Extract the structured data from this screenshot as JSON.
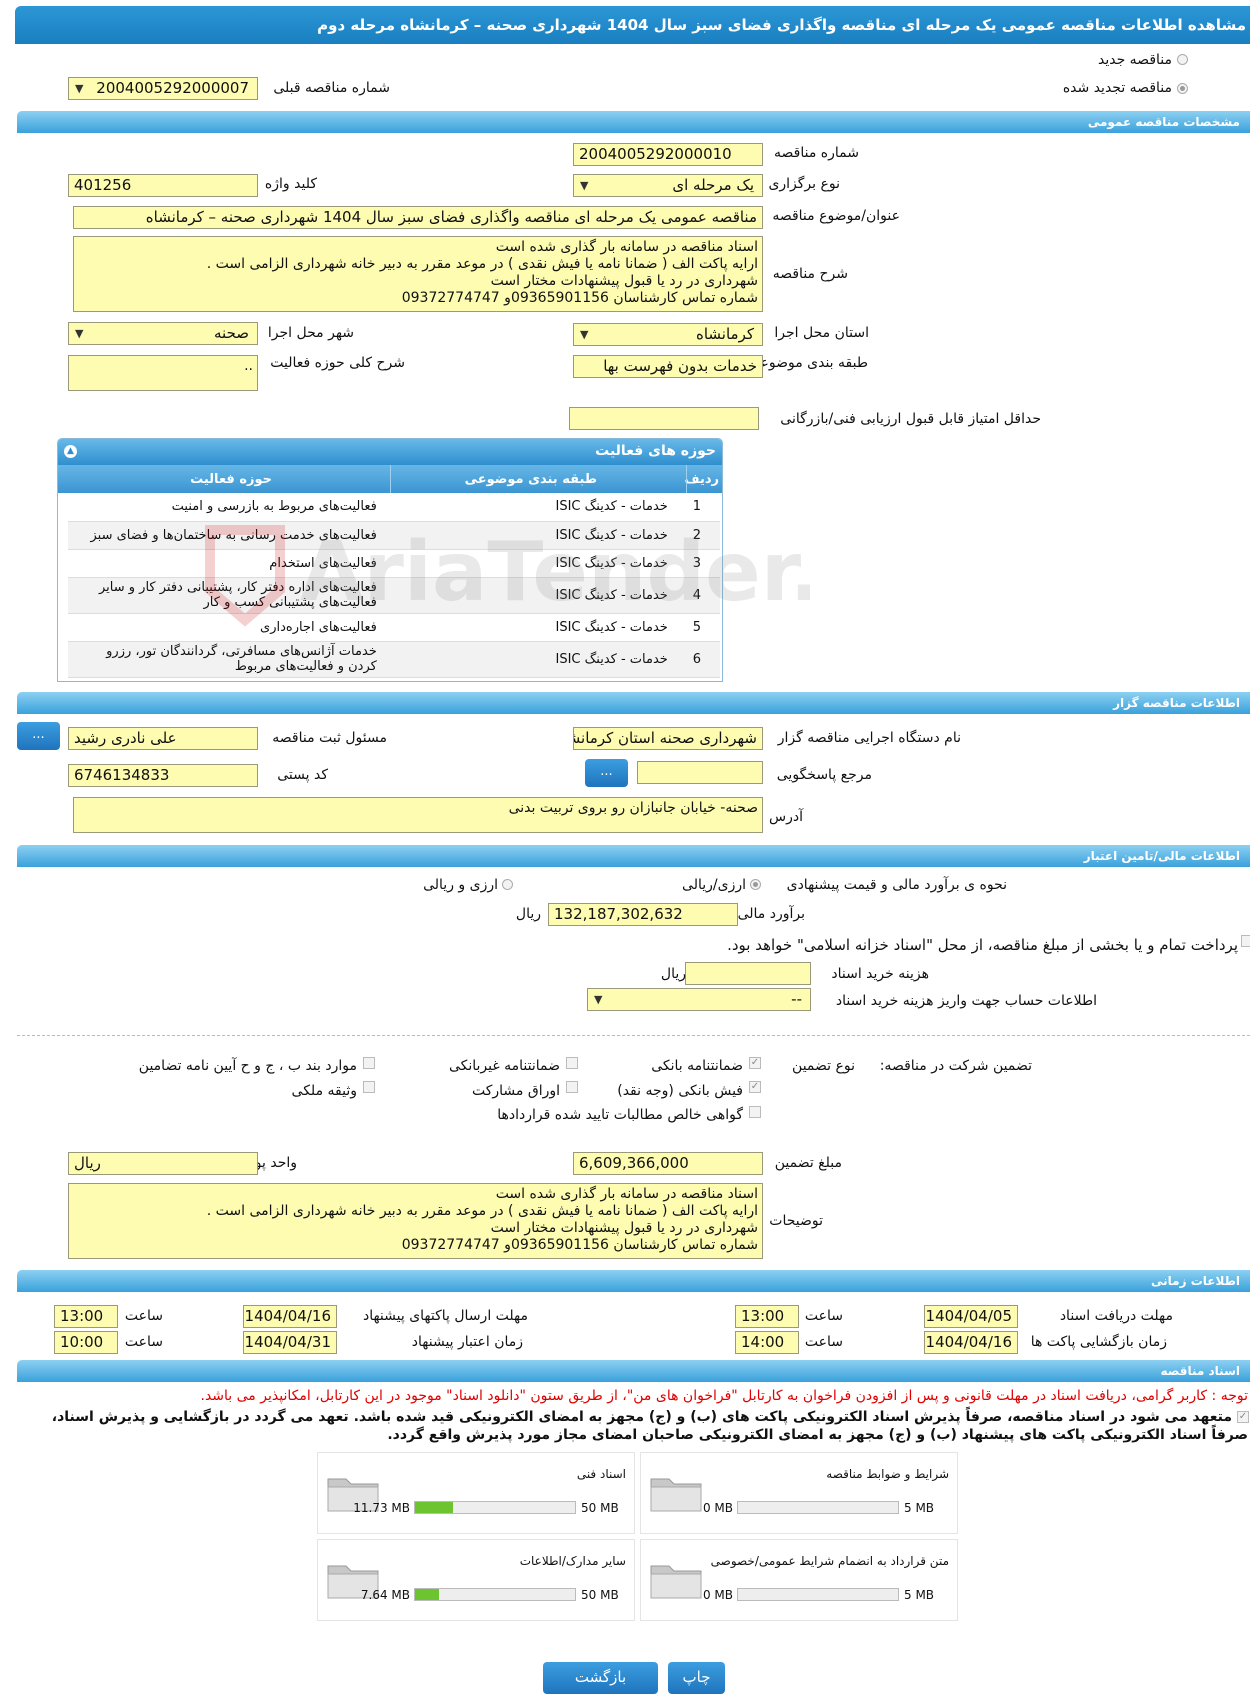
{
  "page_title": "مشاهده اطلاعات مناقصه عمومی یک مرحله ای مناقصه واگذاری فضای سبز سال 1404 شهرداری صحنه – کرمانشاه مرحله دوم",
  "top": {
    "new_tender": "مناقصه جدید",
    "renewed_tender": "مناقصه تجدید شده",
    "prev_number_label": "شماره مناقصه قبلی",
    "prev_number": "2004005292000007"
  },
  "general": {
    "section": "مشخصات مناقصه عمومی",
    "number_label": "شماره مناقصه",
    "number": "2004005292000010",
    "type_label": "نوع برگزاری",
    "type": "یک مرحله ای",
    "keyword_label": "کلید واژه",
    "keyword": "401256",
    "subject_label": "عنوان/موضوع مناقصه",
    "subject": "مناقصه عمومی یک مرحله ای مناقصه واگذاری  فضای سبز  سال 1404 شهرداری صحنه – کرمانشاه",
    "desc_label": "شرح مناقصه",
    "desc": "اسناد مناقصه  در سامانه بار گذاری شده است\nارایه پاکت الف ( ضمانا نامه یا فیش نقدی ) در موعد مقرر به دبیر خانه شهرداری الزامی است .\nشهرداری در رد یا قبول پیشنهادات مختار است\nشماره تماس کارشناسان 09365901156و 09372774747",
    "province_label": "استان محل اجرا",
    "province": "کرمانشاه",
    "city_label": "شهر محل اجرا",
    "city": "صحنه",
    "category_label": "طبقه بندی موضوعی",
    "category": "خدمات بدون فهرست بها",
    "scope_label": "شرح کلی حوزه فعالیت",
    "scope": "..",
    "min_score_label": "حداقل امتیاز قابل قبول ارزیابی فنی/بازرگانی",
    "min_score": ""
  },
  "activities": {
    "title": "حوزه های فعالیت",
    "col_row": "ردیف",
    "col_category": "طبقه بندی موضوعی",
    "col_field": "حوزه فعالیت",
    "rows": [
      {
        "n": "1",
        "cat": "خدمات - کدینگ ISIC",
        "field": "فعالیت‌های مربوط به بازرسی و امنیت"
      },
      {
        "n": "2",
        "cat": "خدمات - کدینگ ISIC",
        "field": "فعالیت‌های خدمت رسانی به ساختمان‌ها و فضای سبز"
      },
      {
        "n": "3",
        "cat": "خدمات - کدینگ ISIC",
        "field": "فعالیت‌های استخدام"
      },
      {
        "n": "4",
        "cat": "خدمات - کدینگ ISIC",
        "field": "فعالیت‌های  اداره دفتر کار، پشتیبانی دفتر کار و سایر فعالیت‌های پشتیبانی کسب و کار"
      },
      {
        "n": "5",
        "cat": "خدمات - کدینگ ISIC",
        "field": "فعالیت‌های اجاره‌داری"
      },
      {
        "n": "6",
        "cat": "خدمات - کدینگ ISIC",
        "field": "خدمات آژانس‌های مسافرتی، گردانندگان تور، رزرو کردن و فعالیت‌های مربوط"
      }
    ]
  },
  "organizer": {
    "section": "اطلاعات مناقصه گزار",
    "agency_label": "نام دستگاه اجرایی مناقصه گزار",
    "agency": "شهرداری صحنه استان کرمانشاه",
    "responsible_label": "مسئول ثبت مناقصه",
    "responsible": "علی نادری رشید",
    "ref_label": "مرجع پاسخگویی",
    "ref": "",
    "postal_label": "کد پستی",
    "postal": "6746134833",
    "address_label": "آدرس",
    "address": "صحنه-  خیابان جانبازان  رو بروی تربیت بدنی",
    "dots": "..."
  },
  "finance": {
    "section": "اطلاعات مالی/تامین اعتبار",
    "method_label": "نحوه ی برآورد مالی و قیمت پیشنهادی",
    "opt1": "ارزی/ریالی",
    "opt2": "ارزی و ریالی",
    "estimate_label": "برآورد مالی",
    "estimate": "132,187,302,632",
    "rial": "ریال",
    "treasury_text": "پرداخت تمام و یا بخشی از مبلغ مناقصه، از محل \"اسناد خزانه اسلامی\" خواهد بود.",
    "doc_fee_label": "هزینه خرید اسناد",
    "doc_fee": "",
    "account_label": "اطلاعات حساب جهت واریز هزینه خرید اسناد",
    "account": "--"
  },
  "guarantee": {
    "label": "تضمین شرکت در مناقصه:",
    "type_label": "نوع تضمین",
    "bank": "ضمانتنامه بانکی",
    "nonbank": "ضمانتنامه غیربانکی",
    "items_bch": "موارد بند ب ، ج و ح آیین نامه تضامین",
    "cash": "فیش بانکی (وجه نقد)",
    "bonds": "اوراق مشارکت",
    "property": "وثیقه ملکی",
    "claims": "گواهی خالص مطالبات تایید شده قراردادها",
    "amount_label": "مبلغ تضمین",
    "amount": "6,609,366,000",
    "currency_label": "واحد پول",
    "currency": "ریال",
    "notes_label": "توضیحات",
    "notes": "اسناد مناقصه  در سامانه بار گذاری شده است\nارایه پاکت الف ( ضمانا نامه یا فیش نقدی ) در موعد مقرر به دبیر خانه شهرداری الزامی است .\nشهرداری در رد یا قبول پیشنهادات مختار است\nشماره تماس کارشناسان 09365901156و 09372774747"
  },
  "timing": {
    "section": "اطلاعات زمانی",
    "doc_deadline_label": "مهلت دریافت اسناد",
    "doc_deadline": "1404/04/05",
    "time_label": "ساعت",
    "doc_time": "13:00",
    "send_deadline_label": "مهلت ارسال پاکتهای پیشنهاد",
    "send_deadline": "1404/04/16",
    "send_time": "13:00",
    "open_label": "زمان بازگشایی پاکت ها",
    "open_date": "1404/04/16",
    "open_time": "14:00",
    "valid_label": "زمان اعتبار پیشنهاد",
    "valid_date": "1404/04/31",
    "valid_time": "10:00"
  },
  "docs": {
    "section": "اسناد مناقصه",
    "notice": "توجه : کاربر گرامی، دریافت اسناد در مهلت قانونی و پس از افزودن فراخوان به کارتابل \"فراخوان های من\"، از طریق ستون \"دانلود اسناد\" موجود در این کارتابل، امکانپذیر می باشد.",
    "commit1": "متعهد می شود در اسناد مناقصه، صرفاً پذیرش اسناد الکترونیکی پاکت های (ب) و (ج) مجهز به امضای الکترونیکی قید شده باشد. تعهد می گردد در بازگشایی و پذیرش اسناد،",
    "commit2": "صرفاً اسناد الکترونیکی پاکت های پیشنهاد (ب) و (ج) مجهز به امضای الکترونیکی صاحبان امضای مجاز مورد پذیرش واقع گردد.",
    "items": [
      {
        "name": "شرایط و ضوابط مناقصه",
        "used": "0 MB",
        "max": "5 MB",
        "fraction": 0.0
      },
      {
        "name": "اسناد فنی",
        "used": "11.73 MB",
        "max": "50 MB",
        "fraction": 0.2346
      },
      {
        "name": "متن قرارداد به انضمام شرایط عمومی/خصوصی",
        "used": "0 MB",
        "max": "5 MB",
        "fraction": 0.0
      },
      {
        "name": "سایر مدارک/اطلاعات",
        "used": "7.64 MB",
        "max": "50 MB",
        "fraction": 0.1528
      }
    ]
  },
  "buttons": {
    "back": "بازگشت",
    "print": "چاپ"
  },
  "colors": {
    "header": "#2c97d6",
    "field_bg": "#fdfcb0",
    "notice": "#e00000"
  }
}
